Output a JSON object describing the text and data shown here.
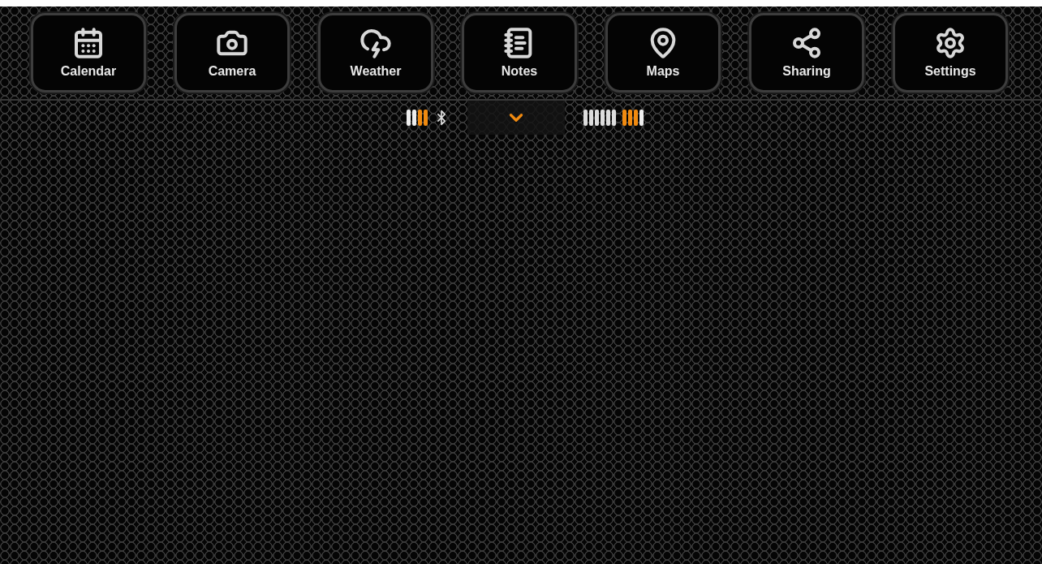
{
  "apps": [
    {
      "label": "Calendar",
      "kind": "calendar"
    },
    {
      "label": "Camera",
      "kind": "camera"
    },
    {
      "label": "Weather",
      "kind": "weather"
    },
    {
      "label": "Notes",
      "kind": "notes"
    },
    {
      "label": "Maps",
      "kind": "maps"
    },
    {
      "label": "Sharing",
      "kind": "sharing"
    },
    {
      "label": "Settings",
      "kind": "settings"
    }
  ]
}
